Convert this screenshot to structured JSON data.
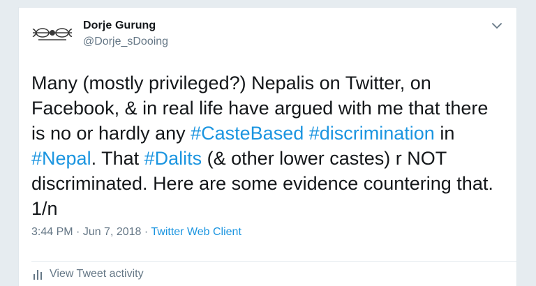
{
  "author": {
    "name": "Dorje Gurung",
    "handle": "@Dorje_sDooing"
  },
  "tweet": {
    "seg1": "Many (mostly privileged?) Nepalis on Twitter, on Facebook, & in real life have argued with me that there is no or hardly any ",
    "tag1": "#CasteBased",
    "seg2": " ",
    "tag2": "#discrimination",
    "seg3": " in ",
    "tag3": "#Nepal",
    "seg4": ". That ",
    "tag4": "#Dalits",
    "seg5": " (& other lower castes) r NOT discriminated. Here are some evidence countering that. 1/n"
  },
  "meta": {
    "time": "3:44 PM",
    "separator1": " · ",
    "date": "Jun 7, 2018",
    "separator2": " · ",
    "client": "Twitter Web Client"
  },
  "activity": {
    "label": "View Tweet activity"
  },
  "icons": {
    "avatar": "vajra-logo-avatar",
    "caret": "chevron-down-icon",
    "activity": "bar-chart-icon"
  },
  "colors": {
    "link": "#1b95e0",
    "text": "#14171a",
    "muted": "#657786",
    "background": "#e6ecf0"
  }
}
